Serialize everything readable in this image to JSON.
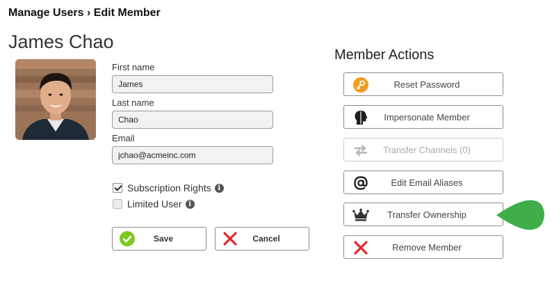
{
  "breadcrumb": {
    "text": "Manage Users › Edit Member"
  },
  "member": {
    "name": "James Chao"
  },
  "form": {
    "first_name_label": "First name",
    "first_name_value": "James",
    "last_name_label": "Last name",
    "last_name_value": "Chao",
    "email_label": "Email",
    "email_value": "jchao@acmeinc.com",
    "subscription_rights_label": "Subscription Rights",
    "subscription_rights_checked": true,
    "limited_user_label": "Limited User",
    "limited_user_checked": false,
    "info_glyph": "i",
    "save_label": "Save",
    "cancel_label": "Cancel"
  },
  "actions": {
    "title": "Member Actions",
    "items": [
      {
        "label": "Reset Password",
        "icon": "key-icon",
        "color": "#f39c1f",
        "enabled": true
      },
      {
        "label": "Impersonate Member",
        "icon": "head-icon",
        "color": "#222222",
        "enabled": true
      },
      {
        "label": "Transfer Channels (0)",
        "icon": "transfer-arrows-icon",
        "color": "#b5b5b5",
        "enabled": false
      },
      {
        "label": "Edit Email Aliases",
        "icon": "at-sign-icon",
        "color": "#222222",
        "enabled": true
      },
      {
        "label": "Transfer Ownership",
        "icon": "crown-icon",
        "color": "#333333",
        "enabled": true
      },
      {
        "label": "Remove Member",
        "icon": "x-icon",
        "color": "#e5252a",
        "enabled": true
      }
    ]
  },
  "colors": {
    "save_green": "#7cc820",
    "cancel_red": "#e5252a",
    "pointer_green": "#3fae49"
  }
}
